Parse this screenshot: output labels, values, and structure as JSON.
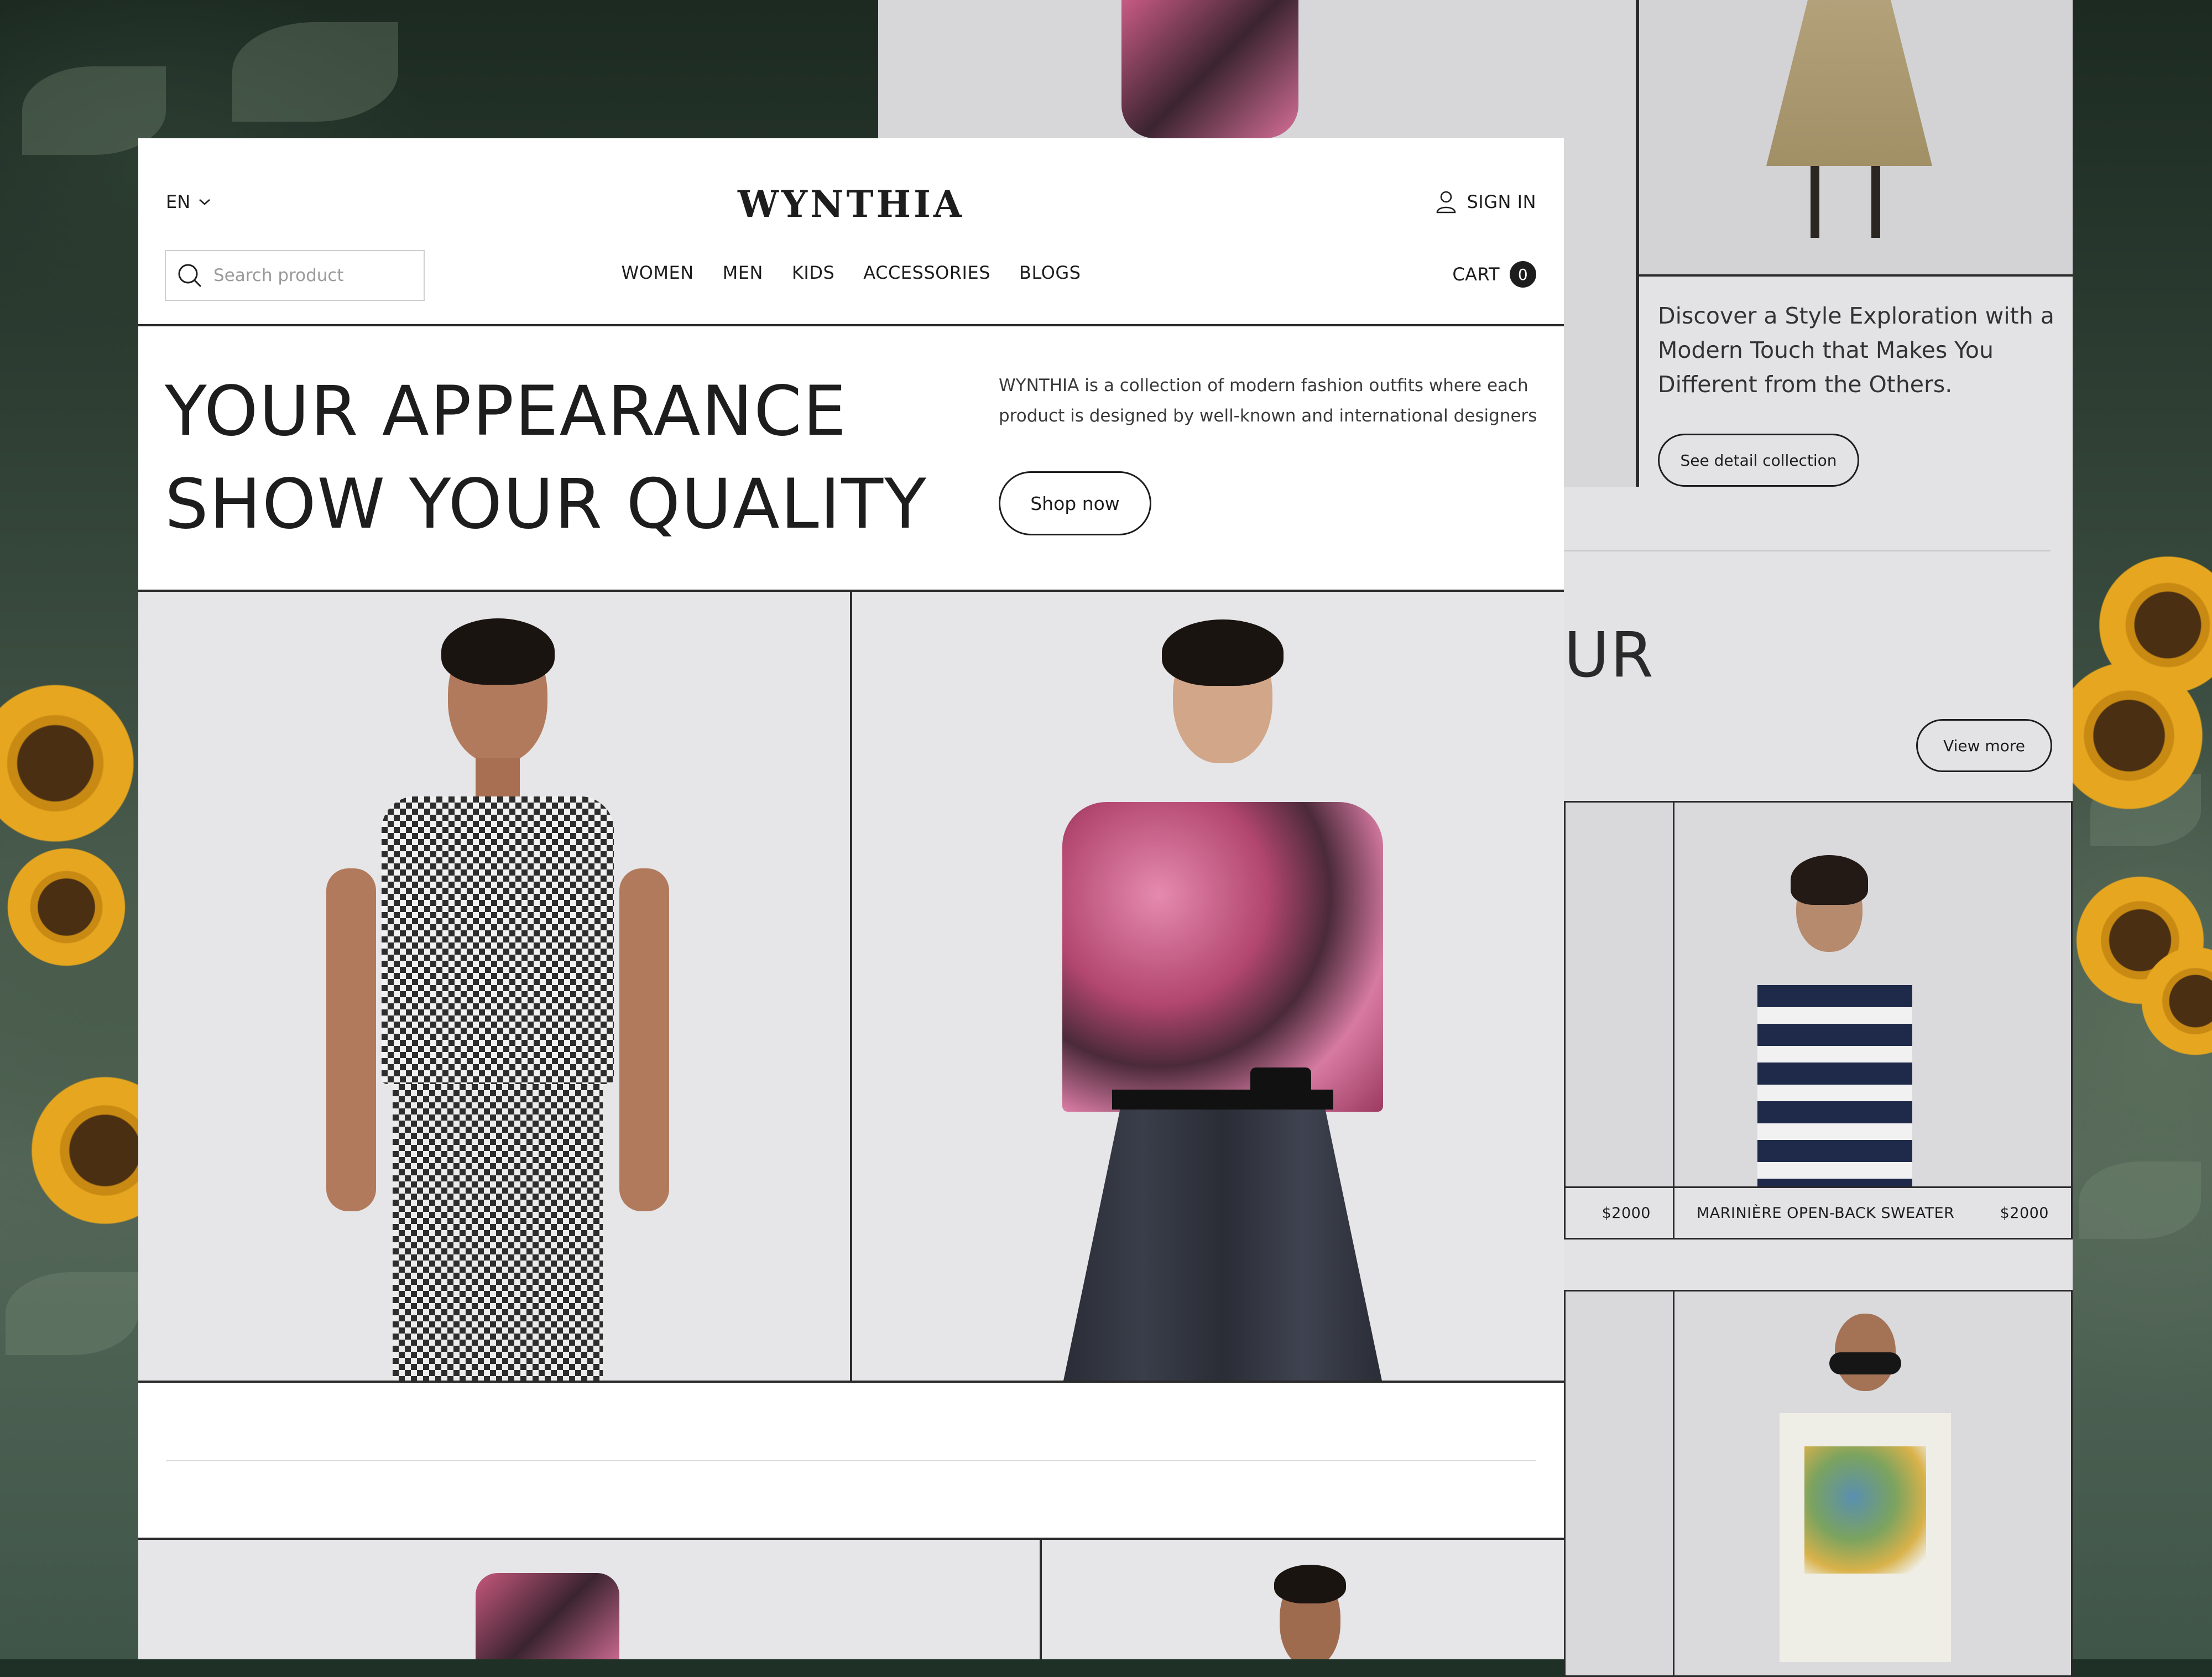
{
  "header": {
    "language": "EN",
    "brand": "WYNTHIA",
    "sign_in": "SIGN IN",
    "search_placeholder": "Search product",
    "nav": [
      "WOMEN",
      "MEN",
      "KIDS",
      "ACCESSORIES",
      "BLOGS"
    ],
    "cart_label": "CART",
    "cart_count": "0"
  },
  "hero": {
    "title_line1": "YOUR APPEARANCE",
    "title_line2": "SHOW YOUR QUALITY",
    "description": "WYNTHIA is a collection of modern fashion outfits where each product is designed by well-known and international designers",
    "cta": "Shop now"
  },
  "back_panel": {
    "tagline": "Discover a Style Exploration with a Modern Touch that Makes You Different from the Others.",
    "detail_button": "See detail collection",
    "heading_fragment": "UR",
    "view_more": "View more",
    "products": [
      {
        "name": "",
        "price": "$2000"
      },
      {
        "name": "MARINIÈRE OPEN-BACK SWEATER",
        "price": "$2000"
      }
    ]
  },
  "colors": {
    "ink": "#1d1d1d",
    "panel_bg": "#ffffff",
    "photo_bg": "#e6e6e8",
    "back_panel_bg": "#e3e3e5"
  }
}
